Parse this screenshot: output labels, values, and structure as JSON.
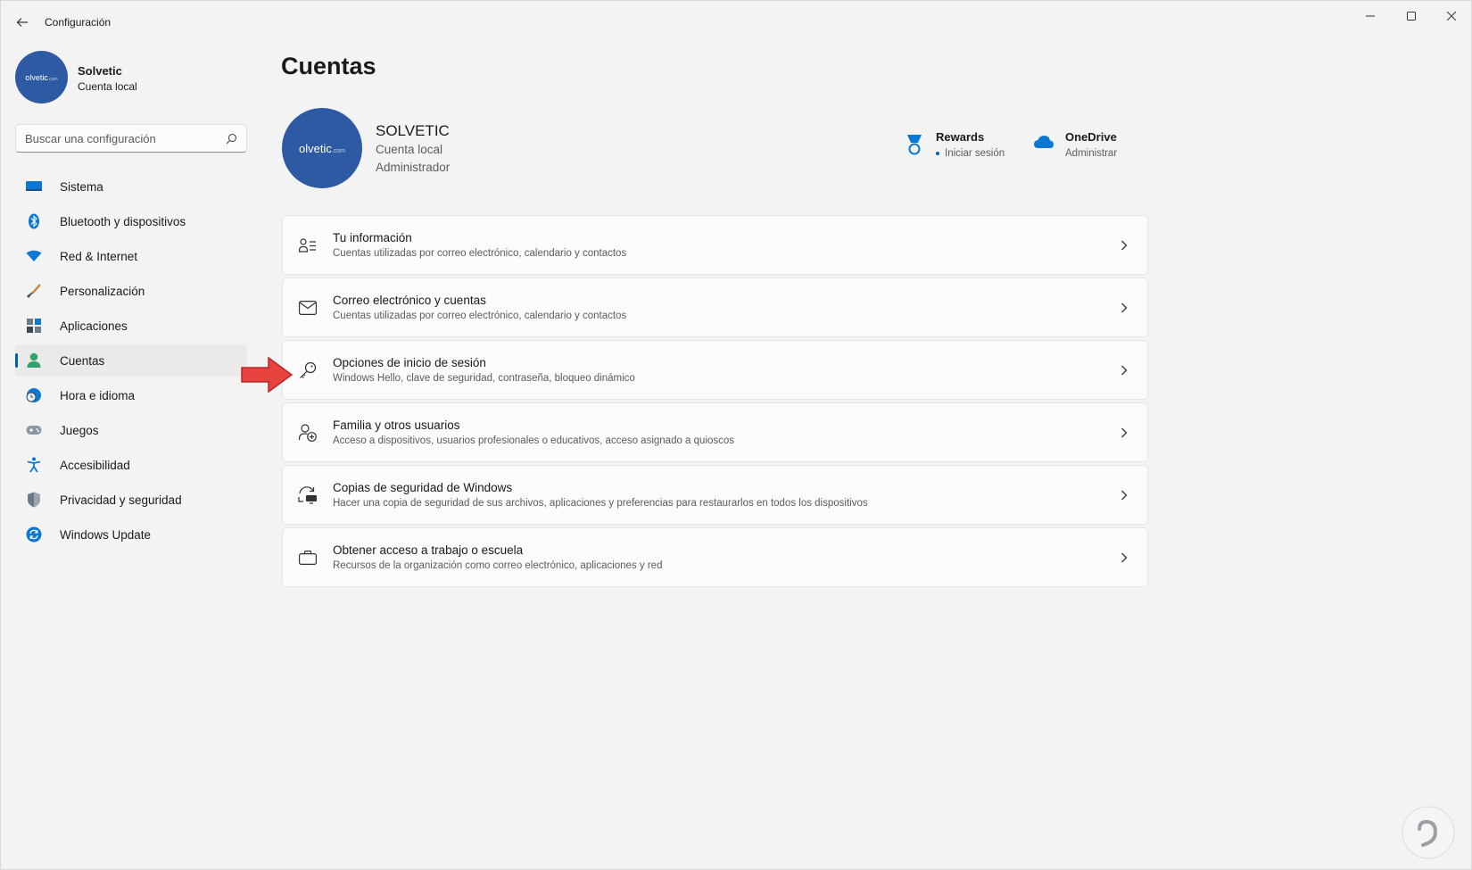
{
  "window": {
    "title": "Configuración"
  },
  "sidebar": {
    "user": {
      "name": "Solvetic",
      "account_type": "Cuenta local",
      "avatar_text": "olvetic",
      "avatar_suffix": ".com"
    },
    "search": {
      "placeholder": "Buscar una configuración"
    },
    "items": [
      {
        "label": "Sistema",
        "icon": "monitor-icon"
      },
      {
        "label": "Bluetooth y dispositivos",
        "icon": "bluetooth-icon"
      },
      {
        "label": "Red & Internet",
        "icon": "wifi-icon"
      },
      {
        "label": "Personalización",
        "icon": "brush-icon"
      },
      {
        "label": "Aplicaciones",
        "icon": "apps-icon"
      },
      {
        "label": "Cuentas",
        "icon": "person-icon",
        "active": true
      },
      {
        "label": "Hora e idioma",
        "icon": "globe-clock-icon"
      },
      {
        "label": "Juegos",
        "icon": "gamepad-icon"
      },
      {
        "label": "Accesibilidad",
        "icon": "accessibility-icon"
      },
      {
        "label": "Privacidad y seguridad",
        "icon": "shield-icon"
      },
      {
        "label": "Windows Update",
        "icon": "update-icon"
      }
    ]
  },
  "main": {
    "title": "Cuentas",
    "profile": {
      "name": "SOLVETIC",
      "account_type": "Cuenta local",
      "role": "Administrador",
      "avatar_text": "olvetic",
      "avatar_suffix": ".com"
    },
    "services": {
      "rewards": {
        "title": "Rewards",
        "subtitle": "Iniciar sesión",
        "icon": "medal-icon"
      },
      "onedrive": {
        "title": "OneDrive",
        "subtitle": "Administrar",
        "icon": "cloud-icon"
      }
    },
    "cards": [
      {
        "title": "Tu información",
        "description": "Cuentas utilizadas por correo electrónico, calendario y contactos",
        "icon": "person-list-icon"
      },
      {
        "title": "Correo electrónico y cuentas",
        "description": "Cuentas utilizadas por correo electrónico, calendario y contactos",
        "icon": "mail-icon"
      },
      {
        "title": "Opciones de inicio de sesión",
        "description": "Windows Hello, clave de seguridad, contraseña, bloqueo dinámico",
        "icon": "key-icon"
      },
      {
        "title": "Familia y otros usuarios",
        "description": "Acceso a dispositivos, usuarios profesionales o educativos, acceso asignado a quioscos",
        "icon": "person-add-icon"
      },
      {
        "title": "Copias de seguridad de Windows",
        "description": "Hacer una copia de seguridad de sus archivos, aplicaciones y preferencias para restaurarlos en todos los dispositivos",
        "icon": "backup-icon"
      },
      {
        "title": "Obtener acceso a trabajo o escuela",
        "description": "Recursos de la organización como correo electrónico, aplicaciones y red",
        "icon": "briefcase-icon"
      }
    ]
  },
  "colors": {
    "accent": "#005fb8",
    "avatar": "#2e5aa3",
    "annotation_arrow": "#e8423f"
  }
}
